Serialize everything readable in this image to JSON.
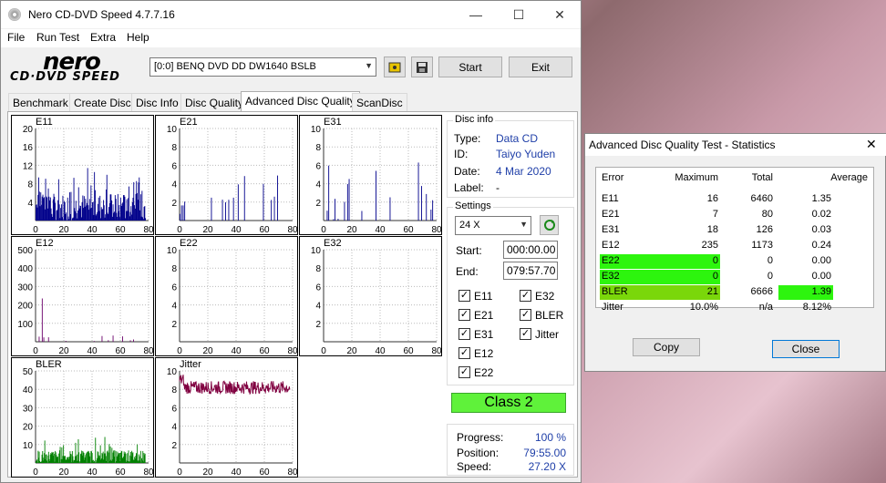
{
  "title": "Nero CD-DVD Speed 4.7.7.16",
  "menu": [
    "File",
    "Run Test",
    "Extra",
    "Help"
  ],
  "logo": {
    "top": "nero",
    "bottom": "CD·DVD SPEED"
  },
  "drive": "[0:0]   BENQ DVD DD DW1640 BSLB",
  "buttons": {
    "start": "Start",
    "exit": "Exit"
  },
  "tabs": [
    "Benchmark",
    "Create Disc",
    "Disc Info",
    "Disc Quality",
    "Advanced Disc Quality",
    "ScanDisc"
  ],
  "disc_info": {
    "title": "Disc info",
    "type_label": "Type:",
    "type": "Data CD",
    "id_label": "ID:",
    "id": "Taiyo Yuden",
    "date_label": "Date:",
    "date": "4 Mar 2020",
    "label_label": "Label:",
    "label": "-"
  },
  "settings": {
    "title": "Settings",
    "speed": "24 X",
    "start_label": "Start:",
    "start": "000:00.00",
    "end_label": "End:",
    "end": "079:57.70"
  },
  "checks": {
    "e11": "E11",
    "e21": "E21",
    "e31": "E31",
    "e12": "E12",
    "e22": "E22",
    "e32": "E32",
    "bler": "BLER",
    "jitter": "Jitter"
  },
  "class": "Class 2",
  "progress": {
    "progress_label": "Progress:",
    "progress": "100 %",
    "position_label": "Position:",
    "position": "79:55.00",
    "speed_label": "Speed:",
    "speed": "27.20 X"
  },
  "chart_data": [
    {
      "name": "E11",
      "type": "bar",
      "color": "#00008b",
      "ylim": [
        0,
        20
      ],
      "yticks": [
        4,
        8,
        12,
        16,
        20
      ],
      "xticks": [
        0,
        20,
        40,
        60,
        80
      ]
    },
    {
      "name": "E21",
      "type": "bar",
      "color": "#00008b",
      "ylim": [
        0,
        10
      ],
      "yticks": [
        2,
        4,
        6,
        8,
        10
      ],
      "xticks": [
        0,
        20,
        40,
        60,
        80
      ]
    },
    {
      "name": "E31",
      "type": "bar",
      "color": "#00008b",
      "ylim": [
        0,
        10
      ],
      "yticks": [
        2,
        4,
        6,
        8,
        10
      ],
      "xticks": [
        0,
        20,
        40,
        60,
        80
      ]
    },
    {
      "name": "E12",
      "type": "bar",
      "color": "#6a006a",
      "ylim": [
        0,
        500
      ],
      "yticks": [
        100,
        200,
        300,
        400,
        500
      ],
      "xticks": [
        0,
        20,
        40,
        60,
        80
      ]
    },
    {
      "name": "E22",
      "type": "bar",
      "color": "#6a006a",
      "ylim": [
        0,
        10
      ],
      "yticks": [
        2,
        4,
        6,
        8,
        10
      ],
      "xticks": [
        0,
        20,
        40,
        60,
        80
      ]
    },
    {
      "name": "E32",
      "type": "bar",
      "color": "#6a006a",
      "ylim": [
        0,
        10
      ],
      "yticks": [
        2,
        4,
        6,
        8,
        10
      ],
      "xticks": [
        0,
        20,
        40,
        60,
        80
      ]
    },
    {
      "name": "BLER",
      "type": "bar",
      "color": "#008000",
      "ylim": [
        0,
        50
      ],
      "yticks": [
        10,
        20,
        30,
        40,
        50
      ],
      "xticks": [
        0,
        20,
        40,
        60,
        80
      ]
    },
    {
      "name": "Jitter",
      "type": "line",
      "color": "#800040",
      "ylim": [
        0,
        10
      ],
      "yticks": [
        2,
        4,
        6,
        8,
        10
      ],
      "xticks": [
        0,
        20,
        40,
        60,
        80
      ]
    }
  ],
  "stats": {
    "title": "Advanced Disc Quality Test - Statistics",
    "headers": [
      "Error",
      "Maximum",
      "Total",
      "Average"
    ],
    "rows": [
      [
        "E11",
        "16",
        "6460",
        "1.35"
      ],
      [
        "E21",
        "7",
        "80",
        "0.02"
      ],
      [
        "E31",
        "18",
        "126",
        "0.03"
      ],
      [
        "E12",
        "235",
        "1173",
        "0.24"
      ],
      [
        "E22",
        "0",
        "0",
        "0.00"
      ],
      [
        "E32",
        "0",
        "0",
        "0.00"
      ],
      [
        "BLER",
        "21",
        "6666",
        "1.39"
      ],
      [
        "Jitter",
        "10.0%",
        "n/a",
        "8.12%"
      ]
    ],
    "copy": "Copy",
    "close": "Close"
  }
}
